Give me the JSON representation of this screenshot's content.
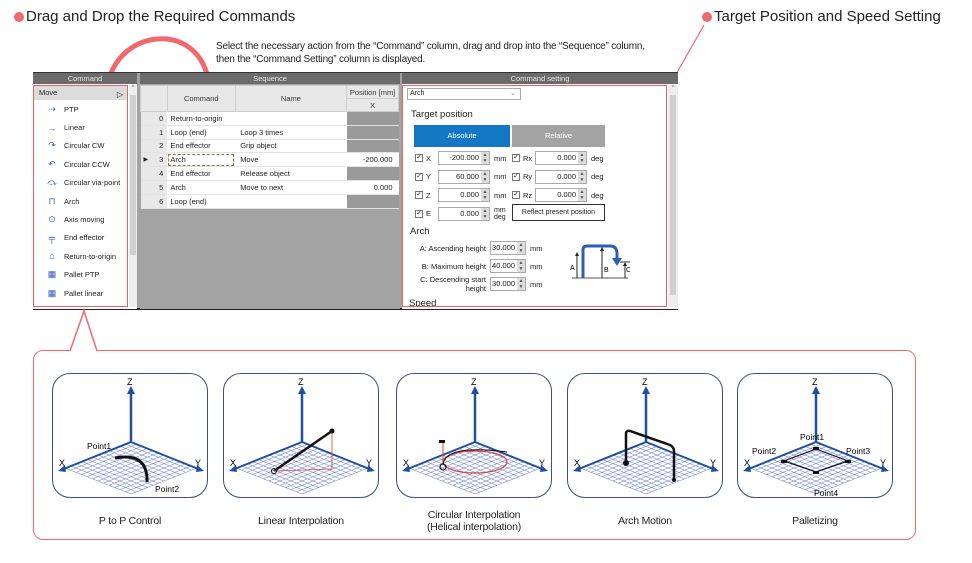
{
  "headings": {
    "left": "Drag and Drop the Required Commands",
    "right": "Target Position and Speed Setting"
  },
  "instruction": {
    "line1": "Select the necessary action from the “Command” column, drag and drop into the “Sequence” column,",
    "line2": "then the “Command Setting” column is displayed."
  },
  "colors": {
    "accent_red": "#f0696f",
    "absolute_blue": "#1377c4",
    "axis_blue": "#1e4fa0"
  },
  "command_panel": {
    "title": "Command",
    "group": "Move",
    "items": [
      {
        "label": "PTP",
        "icon": "ptp-icon",
        "glyph": "⇢"
      },
      {
        "label": "Linear",
        "icon": "linear-icon",
        "glyph": "→"
      },
      {
        "label": "Circular CW",
        "icon": "circular-cw-icon",
        "glyph": "↷"
      },
      {
        "label": "Circular CCW",
        "icon": "circular-ccw-icon",
        "glyph": "↶"
      },
      {
        "label": "Circular via-point",
        "icon": "circular-via-point-icon",
        "glyph": "⤼"
      },
      {
        "label": "Arch",
        "icon": "arch-icon",
        "glyph": "⊓"
      },
      {
        "label": "Axis moving",
        "icon": "axis-moving-icon",
        "glyph": "⊙"
      },
      {
        "label": "End effector",
        "icon": "end-effector-icon",
        "glyph": "╤"
      },
      {
        "label": "Return-to-origin",
        "icon": "return-to-origin-icon",
        "glyph": "⌂"
      },
      {
        "label": "Pallet PTP",
        "icon": "pallet-ptp-icon",
        "glyph": "▦"
      },
      {
        "label": "Pallet linear",
        "icon": "pallet-linear-icon",
        "glyph": "▦"
      }
    ]
  },
  "sequence_panel": {
    "title": "Sequence",
    "columns": {
      "command": "Command",
      "name": "Name",
      "position": "Position [mm]",
      "position_sub": "X"
    },
    "rows": [
      {
        "index": "0",
        "command": "Return-to-origin",
        "name": "",
        "x": ""
      },
      {
        "index": "1",
        "command": "Loop (end)",
        "name": "Loop 3 times",
        "x": ""
      },
      {
        "index": "2",
        "command": "End effector",
        "name": "Grip object",
        "x": ""
      },
      {
        "index": "3",
        "command": "Arch",
        "name": "Move",
        "x": "-200.000"
      },
      {
        "index": "4",
        "command": "End effector",
        "name": "Release object",
        "x": ""
      },
      {
        "index": "5",
        "command": "Arch",
        "name": "Move to next",
        "x": "0.000"
      },
      {
        "index": "6",
        "command": "Loop (end)",
        "name": "",
        "x": ""
      }
    ],
    "selected_index": "3"
  },
  "setting_panel": {
    "title": "Command setting",
    "command_select": "Arch",
    "target_position_title": "Target position",
    "mode_absolute": "Absolute",
    "mode_relative": "Relative",
    "fields_left": [
      {
        "axis": "X",
        "value": "-200.000",
        "unit": "mm",
        "checked": true
      },
      {
        "axis": "Y",
        "value": "60.000",
        "unit": "mm",
        "checked": true
      },
      {
        "axis": "Z",
        "value": "0.000",
        "unit": "mm",
        "checked": true
      },
      {
        "axis": "E",
        "value": "0.000",
        "unit": "mm",
        "unit2": "deg",
        "checked": true
      }
    ],
    "fields_right": [
      {
        "axis": "Rx",
        "value": "0.000",
        "unit": "deg",
        "checked": true
      },
      {
        "axis": "Ry",
        "value": "0.000",
        "unit": "deg",
        "checked": true
      },
      {
        "axis": "Rz",
        "value": "0.000",
        "unit": "deg",
        "checked": true
      }
    ],
    "reflect_button": "Reflect present position",
    "arch_title": "Arch",
    "arch_fields": [
      {
        "label": "A:  Ascending height",
        "value": "30.000",
        "unit": "mm"
      },
      {
        "label": "B:  Maximum height",
        "value": "40.000",
        "unit": "mm"
      },
      {
        "label": "C:  Descending start height",
        "value": "30.000",
        "unit": "mm"
      }
    ],
    "arch_diagram_labels": {
      "a": "A",
      "b": "B",
      "c": "C"
    },
    "speed_title": "Speed"
  },
  "motions": [
    {
      "caption": "P to P Control",
      "caption2": "",
      "labels": {
        "point1": "Point1",
        "point2": "Point2"
      }
    },
    {
      "caption": "Linear Interpolation",
      "caption2": "",
      "labels": {}
    },
    {
      "caption": "Circular Interpolation",
      "caption2": "(Helical interpolation)",
      "labels": {}
    },
    {
      "caption": "Arch Motion",
      "caption2": "",
      "labels": {}
    },
    {
      "caption": "Palletizing",
      "caption2": "",
      "labels": {
        "point1": "Point1",
        "point2": "Point2",
        "point3": "Point3",
        "point4": "Point4"
      }
    }
  ],
  "axis_labels": {
    "x": "X",
    "y": "Y",
    "z": "Z"
  }
}
